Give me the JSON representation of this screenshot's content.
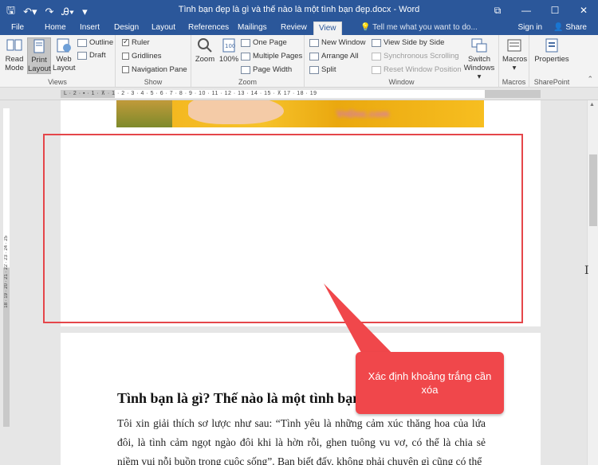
{
  "window": {
    "title": "Tình bạn đẹp là gì và thế nào là một tình bạn đẹp.docx - Word",
    "controls": [
      "⧉",
      "—",
      "☐",
      "✕"
    ],
    "qat": [
      "save-icon",
      "undo-icon",
      "redo-icon",
      "format-painter-icon",
      "customize-icon"
    ]
  },
  "tabs": [
    {
      "label": "File"
    },
    {
      "label": "Home"
    },
    {
      "label": "Insert"
    },
    {
      "label": "Design"
    },
    {
      "label": "Layout"
    },
    {
      "label": "References"
    },
    {
      "label": "Mailings"
    },
    {
      "label": "Review"
    },
    {
      "label": "View"
    }
  ],
  "tellme": "Tell me what you want to do...",
  "signin": "Sign in",
  "share": "Share",
  "ribbon": {
    "views": {
      "label": "Views",
      "read_mode": "Read\nMode",
      "print_layout": "Print\nLayout",
      "web_layout": "Web\nLayout",
      "outline": "Outline",
      "draft": "Draft"
    },
    "show": {
      "label": "Show",
      "ruler": "Ruler",
      "gridlines": "Gridlines",
      "navigation_pane": "Navigation Pane"
    },
    "zoom": {
      "label": "Zoom",
      "zoom": "Zoom",
      "hundred": "100%",
      "one_page": "One Page",
      "multiple_pages": "Multiple Pages",
      "page_width": "Page Width"
    },
    "window": {
      "label": "Window",
      "new_window": "New Window",
      "arrange_all": "Arrange All",
      "split": "Split",
      "view_side_by_side": "View Side by Side",
      "synchronous_scrolling": "Synchronous Scrolling",
      "reset_window_position": "Reset Window Position",
      "switch_windows": "Switch\nWindows ▾"
    },
    "macros": {
      "label": "Macros",
      "macros": "Macros\n▾"
    },
    "sharepoint": {
      "label": "SharePoint",
      "properties": "Properties"
    }
  },
  "ruler": {
    "h_ticks": "L · 2 · ▪ · 1 · ⊼ · 1 · 2 · 3 · 4 · 5 · 6 · 7 · 8 · 9 · 10 · 11 · 12 · 13 · 14 · 15 · ⊼ 17 · 18 · 19",
    "v_ticks": "18 · 19 · 20 · 21 · 22 · 23 · 24 · 25"
  },
  "document": {
    "watermark": "VnDoc.com",
    "heading": "Tình bạn là gì? Thế nào là một tình bạn đẹp?",
    "paragraph": "Tôi xin giải thích sơ lược như sau: “Tình yêu là những cảm xúc thăng hoa của lứa đôi, là tình cảm ngọt ngào đôi khi là hờn rỗi, ghen tuông vu vơ, có thể là chia sẻ niềm vui nỗi buồn trong cuộc sống”. Bạn biết đấy, không phải chuyện gì cũng có thể"
  },
  "annotation": {
    "callout_text": "Xác định khoảng trắng cần xóa",
    "color": "#f0474b"
  }
}
